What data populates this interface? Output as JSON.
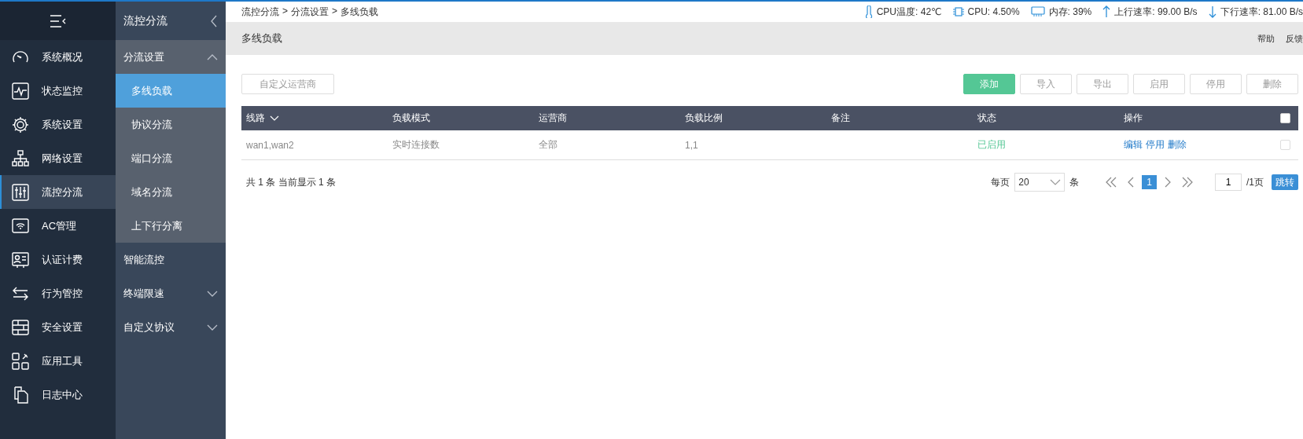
{
  "nav": {
    "items": [
      {
        "label": "系统概况",
        "kind": "gauge",
        "selected": false
      },
      {
        "label": "状态监控",
        "kind": "pulse",
        "selected": false
      },
      {
        "label": "系统设置",
        "kind": "gear",
        "selected": false
      },
      {
        "label": "网络设置",
        "kind": "network",
        "selected": false
      },
      {
        "label": "流控分流",
        "kind": "sliders",
        "selected": true
      },
      {
        "label": "AC管理",
        "kind": "wifi",
        "selected": false
      },
      {
        "label": "认证计费",
        "kind": "idcard",
        "selected": false
      },
      {
        "label": "行为管控",
        "kind": "swap",
        "selected": false
      },
      {
        "label": "安全设置",
        "kind": "wall",
        "selected": false
      },
      {
        "label": "应用工具",
        "kind": "apps",
        "selected": false
      },
      {
        "label": "日志中心",
        "kind": "docs",
        "selected": false
      }
    ]
  },
  "subnav": {
    "title": "流控分流",
    "groups": [
      {
        "label": "分流设置",
        "expanded": true,
        "has_children": true,
        "children": [
          {
            "label": "多线负载",
            "selected": true
          },
          {
            "label": "协议分流",
            "selected": false
          },
          {
            "label": "端口分流",
            "selected": false
          },
          {
            "label": "域名分流",
            "selected": false
          },
          {
            "label": "上下行分离",
            "selected": false
          }
        ]
      },
      {
        "label": "智能流控",
        "expanded": false,
        "has_children": false
      },
      {
        "label": "终端限速",
        "expanded": false,
        "has_children": true
      },
      {
        "label": "自定义协议",
        "expanded": false,
        "has_children": true
      }
    ]
  },
  "breadcrumb": {
    "separator": ">",
    "items": [
      "流控分流",
      "分流设置",
      "多线负载"
    ]
  },
  "stats": [
    {
      "kind": "thermometer",
      "text": "CPU温度: 42℃"
    },
    {
      "kind": "chip",
      "text": "CPU: 4.50%"
    },
    {
      "kind": "memory",
      "text": "内存: 39%"
    },
    {
      "kind": "up",
      "text": "上行速率: 99.00 B/s"
    },
    {
      "kind": "down",
      "text": "下行速率: 81.00 B/s"
    }
  ],
  "page_title": "多线负载",
  "header_links": [
    "帮助",
    "反馈"
  ],
  "left_button": "自定义运营商",
  "actions": [
    {
      "label": "添加",
      "kind": "primary"
    },
    {
      "label": "导入",
      "kind": "plain"
    },
    {
      "label": "导出",
      "kind": "plain"
    },
    {
      "label": "启用",
      "kind": "plain"
    },
    {
      "label": "停用",
      "kind": "plain"
    },
    {
      "label": "删除",
      "kind": "plain"
    }
  ],
  "table": {
    "columns": [
      {
        "label": "线路",
        "sortable": true
      },
      {
        "label": "负载模式",
        "sortable": false
      },
      {
        "label": "运营商",
        "sortable": false
      },
      {
        "label": "负载比例",
        "sortable": false
      },
      {
        "label": "备注",
        "sortable": false
      },
      {
        "label": "状态",
        "sortable": false
      },
      {
        "label": "操作",
        "sortable": false
      }
    ],
    "select_all": false,
    "rows": [
      {
        "cells": [
          "wan1,wan2",
          "实时连接数",
          "全部",
          "1,1",
          ""
        ],
        "status": "已启用",
        "enabled": true,
        "operations": [
          "编辑",
          "停用",
          "删除"
        ],
        "checked": false
      }
    ]
  },
  "pagination": {
    "summary": "共 1 条 当前显示 1 条",
    "per_page_label": "每页",
    "per_page": "20",
    "unit": "条",
    "pages": [
      {
        "label": "1",
        "selected": true
      }
    ],
    "page_input": "1",
    "total": "/1页",
    "jump": "跳转"
  }
}
